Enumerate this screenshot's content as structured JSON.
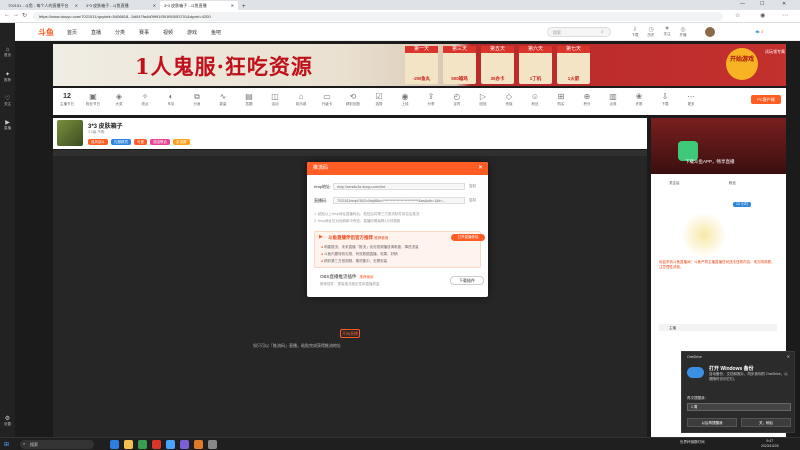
{
  "browser": {
    "tabs": [
      {
        "label": "702151 - 斗鱼 - 每个人的直播平台"
      },
      {
        "label": "3*3 皮肤箱子 - 斗鱼直播"
      },
      {
        "label": "3*3 皮肤箱子 - 斗鱼直播"
      }
    ],
    "url": "https://www.douyu.com/7021511/quyinbi=5406818...5d047fa4d09f91f391f50053701&dyctrl=4200"
  },
  "rail": {
    "items": [
      {
        "label": "首页"
      },
      {
        "label": "推荐"
      },
      {
        "label": "关注"
      },
      {
        "label": "直播"
      },
      {
        "label": "设置"
      }
    ]
  },
  "site": {
    "logo": "斗鱼",
    "nav": [
      "首页",
      "直播",
      "分类",
      "赛事",
      "视频",
      "游戏",
      "鱼吧"
    ],
    "search_placeholder": "搜索",
    "header_icons": [
      {
        "label": "下载",
        "icon": "download-icon"
      },
      {
        "label": "历史",
        "icon": "history-icon"
      },
      {
        "label": "关注",
        "icon": "follow-icon"
      },
      {
        "label": "开播",
        "icon": "broadcast-icon"
      }
    ],
    "fish_count": "2"
  },
  "banner": {
    "title": "1人鬼服·狂吃资源",
    "days": [
      {
        "head": "第一天",
        "value": "-2W鱼丸"
      },
      {
        "head": "第三天",
        "value": "500箱鸡"
      },
      {
        "head": "第五天",
        "value": "30办卡"
      },
      {
        "head": "第六天",
        "value": "1丁机"
      },
      {
        "head": "第七天",
        "value": "1火箭"
      }
    ],
    "start_label": "开始游戏",
    "right_text": "试玩领专属"
  },
  "toolbar": {
    "date": "12",
    "date_label": "主播节日",
    "items": [
      "粉丝节日",
      "大奖",
      "亮点",
      "车队",
      "分身",
      "能量",
      "答题",
      "活动",
      "欢乐城",
      "升级卡",
      "精彩回放",
      "选秀",
      "上线",
      "分享",
      "定时",
      "回放",
      "贵族",
      "粉丝",
      "购买",
      "积分",
      "点券",
      "许愿",
      "下载",
      "更多"
    ],
    "pc_button": "PC客户端"
  },
  "room": {
    "title": "3*3 皮肤箱子",
    "tags": [
      {
        "label": "逐风战斗",
        "color": "#ff5d23"
      },
      {
        "label": "礼服精灵",
        "color": "#2e86de"
      },
      {
        "label": "可爱",
        "color": "#ff5d23"
      },
      {
        "label": "强强联合",
        "color": "#e84393"
      },
      {
        "label": "友谊赛",
        "color": "#ff9f1a"
      }
    ],
    "meta": "3 2级 不明"
  },
  "player": {
    "prompt_button": "开始直播",
    "hint": "如只可以「推流码」直播，粘贴完成获得推流地址"
  },
  "modal": {
    "title": "推流码",
    "rtmp_label": "rtmp地址:",
    "rtmp_value": "rtmp://sendtc3a.douyu.com/live",
    "key_label": "直播码:",
    "key_value": "7021511rtmp01f02c0dq9f&n=**************************&wsAuth=1&fr=...",
    "copy": "复制",
    "note1": "1. 粘贴以上rtmp地址直播码后，粘贴后将第三方推流软件到位后推流",
    "note2": "2. rtmp地址仅对此刷新中有效，直播码需每隔1分钟更新",
    "promo_title": "斗鱼直播伴侣官方推荐",
    "promo_tag": "推荐使用",
    "promo_button": "打开直播伴侣",
    "promo_items": [
      "明星推流、未来直播「推流」优化视频播放清晰度，降低流量",
      "斗鱼内置特效礼物、有效数据直播、效果、好精",
      "精彩第三方音视频、素材集中、无需安装"
    ],
    "obs_title": "OBS直播推流插件",
    "obs_tag": "推荐使用",
    "obs_desc": "推荐插件、提高推流稳定性和直播质量",
    "obs_button": "下载插件"
  },
  "right": {
    "download_title": "下载斗鱼APP，畅享直播",
    "follow_label": "关注后",
    "follow_count": "10 小时",
    "fan_label": "粉丝",
    "notice": "欢迎来到斗鱼直播间！斗鱼严禁主播直播任何违法违规内容，请文明观看，注意理性消费。",
    "user": "主播"
  },
  "toast": {
    "app": "OneDrive",
    "title": "打开 Windows 备份",
    "body": "自动备份、文档和照片，同步到你的 OneDrive，以便随时访问它们。",
    "remind_label": "再次提醒我：",
    "remind_value": "1 周",
    "btn1": "以后再提醒我",
    "btn2": "关，稍后"
  },
  "taskbar": {
    "search": "搜索",
    "tray": "世界杯倒数时间",
    "time": "9:47",
    "date": "2023/10/26"
  }
}
